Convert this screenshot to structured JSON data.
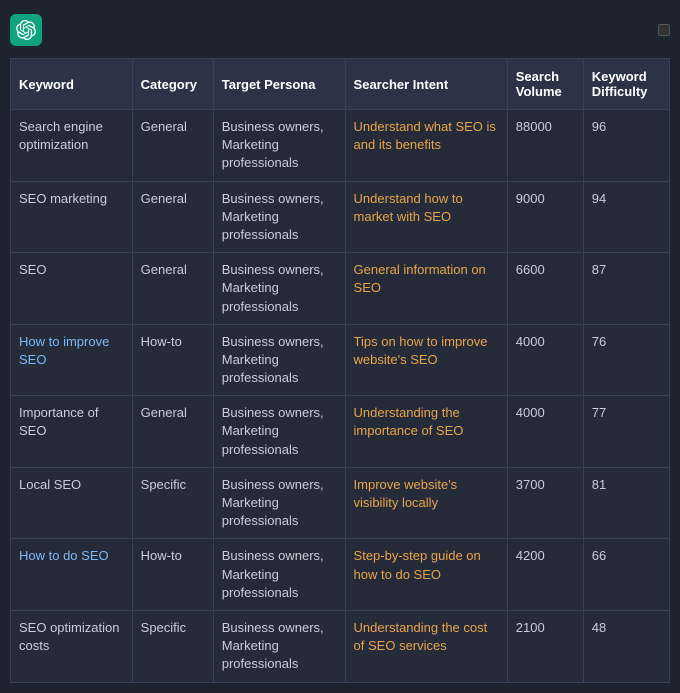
{
  "app": {
    "logo_alt": "OpenAI Logo"
  },
  "table": {
    "headers": [
      {
        "id": "keyword",
        "label": "Keyword"
      },
      {
        "id": "category",
        "label": "Category"
      },
      {
        "id": "target_persona",
        "label": "Target Persona"
      },
      {
        "id": "searcher_intent",
        "label": "Searcher Intent"
      },
      {
        "id": "search_volume",
        "label": "Search Volume"
      },
      {
        "id": "keyword_difficulty",
        "label": "Keyword Difficulty"
      }
    ],
    "rows": [
      {
        "keyword": "Search engine optimization",
        "category": "General",
        "target_persona": "Business owners, Marketing professionals",
        "searcher_intent": "Understand what SEO is and its benefits",
        "search_volume": "88000",
        "keyword_difficulty": "96"
      },
      {
        "keyword": "SEO marketing",
        "category": "General",
        "target_persona": "Business owners, Marketing professionals",
        "searcher_intent": "Understand how to market with SEO",
        "search_volume": "9000",
        "keyword_difficulty": "94"
      },
      {
        "keyword": "SEO",
        "category": "General",
        "target_persona": "Business owners, Marketing professionals",
        "searcher_intent": "General information on SEO",
        "search_volume": "6600",
        "keyword_difficulty": "87"
      },
      {
        "keyword": "How to improve SEO",
        "category": "How-to",
        "target_persona": "Business owners, Marketing professionals",
        "searcher_intent": "Tips on how to improve website's SEO",
        "search_volume": "4000",
        "keyword_difficulty": "76"
      },
      {
        "keyword": "Importance of SEO",
        "category": "General",
        "target_persona": "Business owners, Marketing professionals",
        "searcher_intent": "Understanding the importance of SEO",
        "search_volume": "4000",
        "keyword_difficulty": "77"
      },
      {
        "keyword": "Local SEO",
        "category": "Specific",
        "target_persona": "Business owners, Marketing professionals",
        "searcher_intent": "Improve website's visibility locally",
        "search_volume": "3700",
        "keyword_difficulty": "81"
      },
      {
        "keyword": "How to do SEO",
        "category": "How-to",
        "target_persona": "Business owners, Marketing professionals",
        "searcher_intent": "Step-by-step guide on how to do SEO",
        "search_volume": "4200",
        "keyword_difficulty": "66"
      },
      {
        "keyword": "SEO optimization costs",
        "category": "Specific",
        "target_persona": "Business owners, Marketing professionals",
        "searcher_intent": "Understanding the cost of SEO services",
        "search_volume": "2100",
        "keyword_difficulty": "48"
      }
    ]
  }
}
